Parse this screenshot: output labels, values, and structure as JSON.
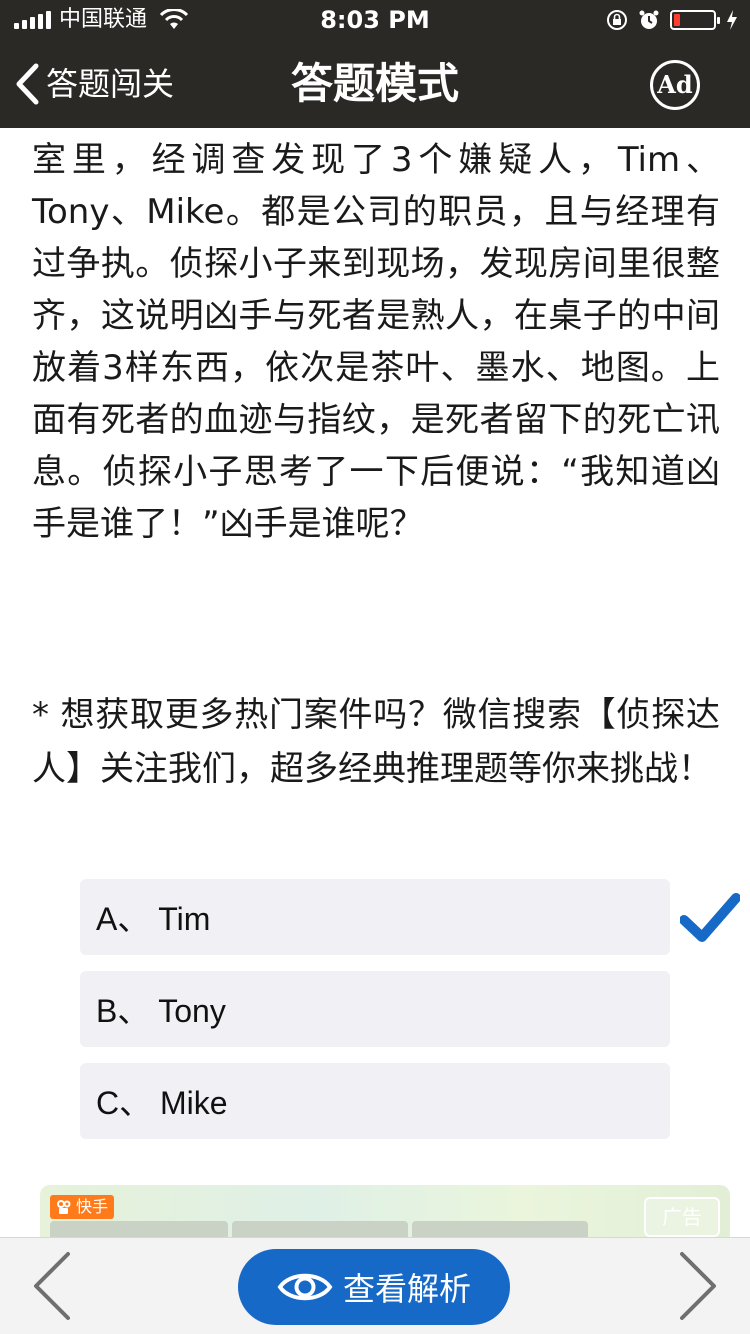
{
  "status_bar": {
    "carrier": "中国联通",
    "time": "8:03 PM",
    "battery_level": 0.15
  },
  "nav": {
    "back_label": "答题闯关",
    "title": "答题模式",
    "ad_label": "Ad"
  },
  "question": {
    "text": "室里，经调查发现了3个嫌疑人，Tim、Tony、Mike。都是公司的职员，且与经理有过争执。侦探小子来到现场，发现房间里很整齐，这说明凶手与死者是熟人，在桌子的中间放着3样东西，依次是茶叶、墨水、地图。上面有死者的血迹与指纹，是死者留下的死亡讯息。侦探小子思考了一下后便说：“我知道凶手是谁了！”凶手是谁呢？"
  },
  "promo": {
    "text": "* 想获取更多热门案件吗？微信搜索【侦探达人】关注我们，超多经典推理题等你来挑战！"
  },
  "options": [
    {
      "label": "A、 Tim",
      "selected": true
    },
    {
      "label": "B、 Tony",
      "selected": false
    },
    {
      "label": "C、 Mike",
      "selected": false
    }
  ],
  "ad": {
    "brand": "快手",
    "tag": "广告"
  },
  "bottom_bar": {
    "analysis_label": "查看解析"
  },
  "colors": {
    "nav_background": "#2b2926",
    "accent_blue": "#1769c8",
    "option_background": "#f0f0f5",
    "battery_red": "#ff3b30"
  },
  "icons": [
    "signal-icon",
    "wifi-icon",
    "orientation-lock-icon",
    "alarm-icon",
    "battery-icon",
    "charging-icon",
    "back-chevron-icon",
    "ad-icon",
    "check-icon",
    "eye-icon",
    "prev-arrow-icon",
    "next-arrow-icon"
  ]
}
